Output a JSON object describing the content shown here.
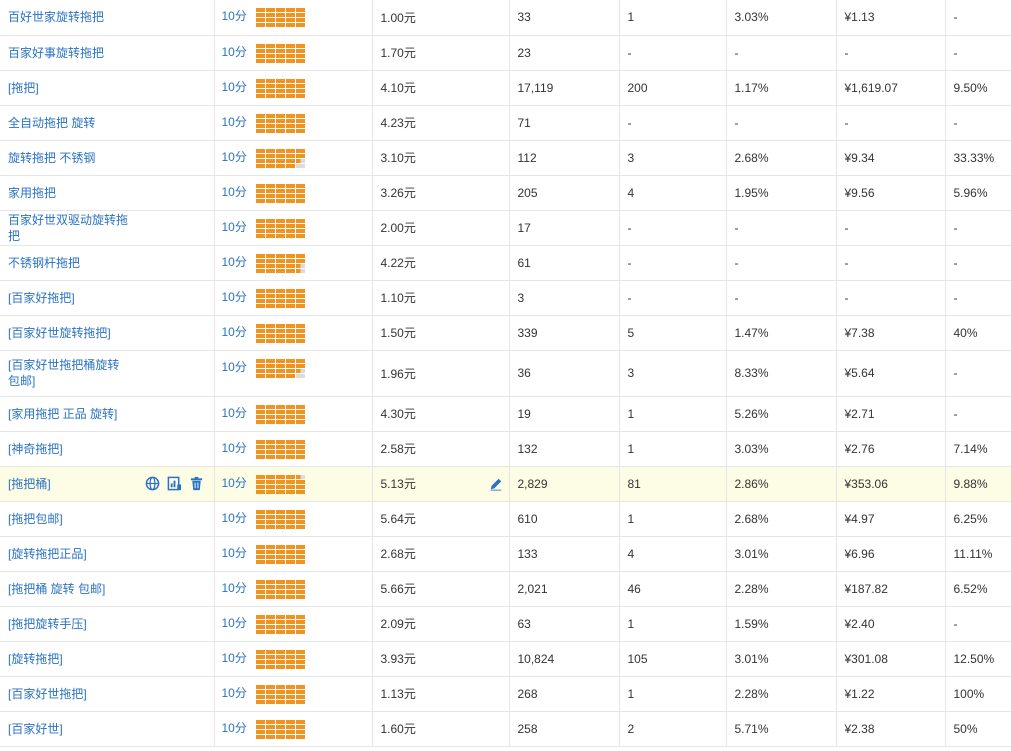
{
  "score_label": "10分",
  "rows": [
    {
      "kw": "百好世家旋转拖把",
      "price": "1.00元",
      "v1": "33",
      "v2": "1",
      "v3": "3.03%",
      "v4": "¥1.13",
      "v5": "-",
      "bar": [
        5,
        5,
        5,
        5
      ]
    },
    {
      "kw": "百家好事旋转拖把",
      "price": "1.70元",
      "v1": "23",
      "v2": "-",
      "v3": "-",
      "v4": "-",
      "v5": "-",
      "bar": [
        5,
        5,
        5,
        5
      ]
    },
    {
      "kw": "[拖把]",
      "price": "4.10元",
      "v1": "17,119",
      "v2": "200",
      "v3": "1.17%",
      "v4": "¥1,619.07",
      "v5": "9.50%",
      "bar": [
        5,
        5,
        5,
        5
      ]
    },
    {
      "kw": "全自动拖把 旋转",
      "price": "4.23元",
      "v1": "71",
      "v2": "-",
      "v3": "-",
      "v4": "-",
      "v5": "-",
      "bar": [
        5,
        5,
        5,
        5
      ]
    },
    {
      "kw": "旋转拖把 不锈钢",
      "price": "3.10元",
      "v1": "112",
      "v2": "3",
      "v3": "2.68%",
      "v4": "¥9.34",
      "v5": "33.33%",
      "bar": [
        5,
        5,
        4.5,
        4
      ]
    },
    {
      "kw": "家用拖把",
      "price": "3.26元",
      "v1": "205",
      "v2": "4",
      "v3": "1.95%",
      "v4": "¥9.56",
      "v5": "5.96%",
      "bar": [
        5,
        5,
        5,
        5
      ]
    },
    {
      "kw": "百家好世双驱动旋转拖把",
      "price": "2.00元",
      "v1": "17",
      "v2": "-",
      "v3": "-",
      "v4": "-",
      "v5": "-",
      "bar": [
        5,
        5,
        5,
        5
      ]
    },
    {
      "kw": "不锈钢杆拖把",
      "price": "4.22元",
      "v1": "61",
      "v2": "-",
      "v3": "-",
      "v4": "-",
      "v5": "-",
      "bar": [
        5,
        5,
        4.5,
        4.5
      ]
    },
    {
      "kw": "[百家好拖把]",
      "price": "1.10元",
      "v1": "3",
      "v2": "-",
      "v3": "-",
      "v4": "-",
      "v5": "-",
      "bar": [
        5,
        5,
        5,
        5
      ]
    },
    {
      "kw": "[百家好世旋转拖把]",
      "price": "1.50元",
      "v1": "339",
      "v2": "5",
      "v3": "1.47%",
      "v4": "¥7.38",
      "v5": "40%",
      "bar": [
        5,
        5,
        5,
        5
      ]
    },
    {
      "kw": "[百家好世拖把桶旋转 包邮]",
      "price": "1.96元",
      "v1": "36",
      "v2": "3",
      "v3": "8.33%",
      "v4": "¥5.64",
      "v5": "-",
      "bar": [
        5,
        5,
        4.5,
        4
      ],
      "tall": true
    },
    {
      "kw": "[家用拖把 正品 旋转]",
      "price": "4.30元",
      "v1": "19",
      "v2": "1",
      "v3": "5.26%",
      "v4": "¥2.71",
      "v5": "-",
      "bar": [
        5,
        5,
        5,
        5
      ]
    },
    {
      "kw": "[神奇拖把]",
      "price": "2.58元",
      "v1": "132",
      "v2": "1",
      "v3": "3.03%",
      "v4": "¥2.76",
      "v5": "7.14%",
      "bar": [
        5,
        5,
        5,
        5
      ]
    },
    {
      "kw": "[拖把桶]",
      "price": "5.13元",
      "v1": "2,829",
      "v2": "81",
      "v3": "2.86%",
      "v4": "¥353.06",
      "v5": "9.88%",
      "bar": [
        4.5,
        5,
        5,
        5
      ],
      "hl": true
    },
    {
      "kw": "[拖把包邮]",
      "price": "5.64元",
      "v1": "610",
      "v2": "1",
      "v3": "2.68%",
      "v4": "¥4.97",
      "v5": "6.25%",
      "bar": [
        5,
        5,
        5,
        5
      ]
    },
    {
      "kw": "[旋转拖把正品]",
      "price": "2.68元",
      "v1": "133",
      "v2": "4",
      "v3": "3.01%",
      "v4": "¥6.96",
      "v5": "11.11%",
      "bar": [
        5,
        5,
        5,
        5
      ]
    },
    {
      "kw": "[拖把桶 旋转 包邮]",
      "price": "5.66元",
      "v1": "2,021",
      "v2": "46",
      "v3": "2.28%",
      "v4": "¥187.82",
      "v5": "6.52%",
      "bar": [
        5,
        5,
        5,
        5
      ]
    },
    {
      "kw": "[拖把旋转手压]",
      "price": "2.09元",
      "v1": "63",
      "v2": "1",
      "v3": "1.59%",
      "v4": "¥2.40",
      "v5": "-",
      "bar": [
        5,
        5,
        5,
        5
      ]
    },
    {
      "kw": "[旋转拖把]",
      "price": "3.93元",
      "v1": "10,824",
      "v2": "105",
      "v3": "3.01%",
      "v4": "¥301.08",
      "v5": "12.50%",
      "bar": [
        5,
        5,
        5,
        5
      ]
    },
    {
      "kw": "[百家好世拖把]",
      "price": "1.13元",
      "v1": "268",
      "v2": "1",
      "v3": "2.28%",
      "v4": "¥1.22",
      "v5": "100%",
      "bar": [
        5,
        5,
        5,
        5
      ]
    },
    {
      "kw": "[百家好世]",
      "price": "1.60元",
      "v1": "258",
      "v2": "2",
      "v3": "5.71%",
      "v4": "¥2.38",
      "v5": "50%",
      "bar": [
        5,
        5,
        5,
        5
      ]
    }
  ],
  "icons": {
    "globe": "globe-icon",
    "chart": "chart-icon",
    "trash": "trash-icon",
    "edit": "edit-pencil-icon"
  },
  "colors": {
    "link": "#2a72c4",
    "bar_on": "#f2921f",
    "bar_off": "#dcdcdc",
    "highlight": "#fdfde6"
  }
}
